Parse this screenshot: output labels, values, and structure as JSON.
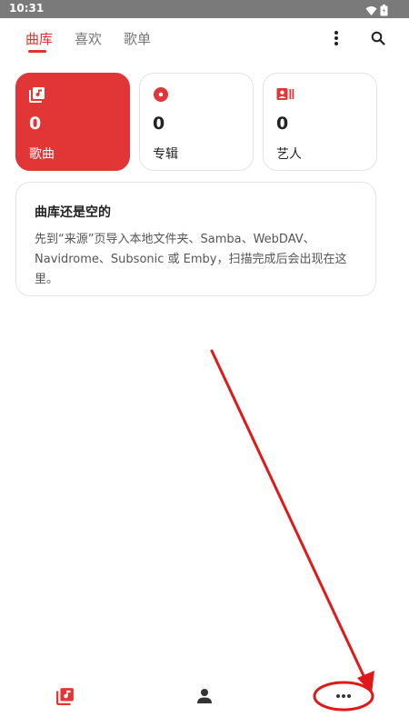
{
  "status_bar": {
    "time": "10:31",
    "wifi_icon": "wifi-icon",
    "battery_icon": "battery-icon"
  },
  "tabs": [
    {
      "label": "曲库",
      "active": true
    },
    {
      "label": "喜欢",
      "active": false
    },
    {
      "label": "歌单",
      "active": false
    }
  ],
  "toolbar": {
    "more_icon": "more-vertical-icon",
    "search_icon": "search-icon"
  },
  "stats": [
    {
      "icon": "music-library-icon",
      "count": "0",
      "label": "歌曲",
      "active": true
    },
    {
      "icon": "disc-icon",
      "count": "0",
      "label": "专辑",
      "active": false
    },
    {
      "icon": "artist-icon",
      "count": "0",
      "label": "艺人",
      "active": false
    }
  ],
  "empty_state": {
    "title": "曲库还是空的",
    "body": "先到“来源”页导入本地文件夹、Samba、WebDAV、Navidrome、Subsonic 或 Emby，扫描完成后会出现在这里。"
  },
  "bottom_nav": [
    {
      "icon": "library-icon",
      "active": true
    },
    {
      "icon": "person-icon",
      "active": false
    },
    {
      "icon": "more-horizontal-icon",
      "active": false
    }
  ],
  "colors": {
    "accent": "#e23535",
    "status_bar": "#7a7a7a",
    "annotation": "#e01818"
  }
}
